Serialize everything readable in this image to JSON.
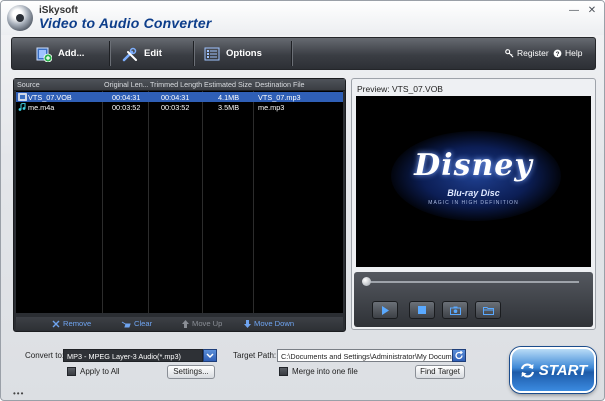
{
  "window": {
    "brand": "iSkysoft",
    "product": "Video to Audio Converter",
    "minimize_glyph": "—",
    "close_glyph": "✕"
  },
  "toolbar": {
    "add_label": "Add...",
    "edit_label": "Edit",
    "options_label": "Options",
    "register_label": "Register",
    "help_label": "Help"
  },
  "file_list": {
    "columns": [
      "Source",
      "Original Len...",
      "Trimmed Length",
      "Estimated Size",
      "Destination File"
    ],
    "rows": [
      {
        "source": "VTS_07.VOB",
        "original": "00:04:31",
        "trimmed": "00:04:31",
        "size": "4.1MB",
        "destination": "VTS_07.mp3",
        "icon": "video-file-icon",
        "selected": true
      },
      {
        "source": "me.m4a",
        "original": "00:03:52",
        "trimmed": "00:03:52",
        "size": "3.5MB",
        "destination": "me.mp3",
        "icon": "music-note-icon",
        "selected": false
      }
    ],
    "actions": {
      "remove": "Remove",
      "clear": "Clear",
      "move_up": "Move Up",
      "move_down": "Move Down"
    }
  },
  "preview": {
    "title": "Preview: VTS_07.VOB",
    "logo_text": "Disney",
    "bluray_text": "Blu-ray Disc",
    "tagline": "MAGIC IN HIGH DEFINITION",
    "seek_progress": 0.0
  },
  "bottom": {
    "convert_to_label": "Convert to:",
    "format_value": "MP3 - MPEG Layer-3 Audio(*.mp3)",
    "apply_all_label": "Apply to All",
    "settings_label": "Settings...",
    "target_path_label": "Target Path:",
    "target_path_value": "C:\\Documents and Settings\\Administrator\\My Documen",
    "merge_label": "Merge into one file",
    "find_target_label": "Find Target",
    "start_label": "START"
  },
  "colors": {
    "accent": "#2f5fb6",
    "toolbar_dark": "#3b3e44",
    "link_blue": "#6fa4f0",
    "title_blue": "#0d3d8a"
  }
}
